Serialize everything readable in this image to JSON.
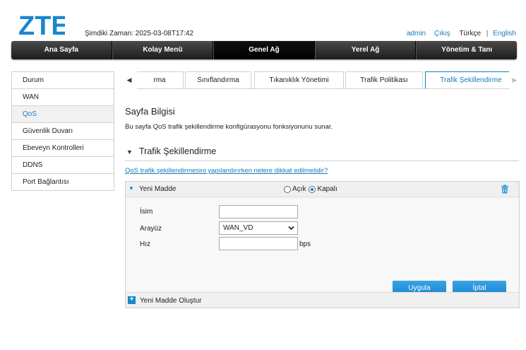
{
  "header": {
    "brand": "ZTE",
    "time_label": "Şimdiki Zaman: 2025-03-08T17:42",
    "links": {
      "admin": "admin",
      "logout": "Çıkış",
      "lang_tr": "Türkçe",
      "separator": "|",
      "lang_en": "English"
    }
  },
  "mainnav": {
    "items": [
      {
        "label": "Ana Sayfa"
      },
      {
        "label": "Kolay Menü"
      },
      {
        "label": "Genel Ağ"
      },
      {
        "label": "Yerel Ağ"
      },
      {
        "label": "Yönetim & Tanı"
      }
    ],
    "active_index": 2
  },
  "sidebar": {
    "items": [
      {
        "label": "Durum"
      },
      {
        "label": "WAN"
      },
      {
        "label": "QoS"
      },
      {
        "label": "Güvenlik Duvarı"
      },
      {
        "label": "Ebeveyn Kontrolleri"
      },
      {
        "label": "DDNS"
      },
      {
        "label": "Port Bağlantısı"
      }
    ],
    "active_index": 2
  },
  "tabs": {
    "items": [
      {
        "label": "rma"
      },
      {
        "label": "Sınıflandırma"
      },
      {
        "label": "Tıkanıklık Yönetimi"
      },
      {
        "label": "Trafik Politikası"
      },
      {
        "label": "Trafik Şekillendirme"
      }
    ],
    "active_index": 4
  },
  "page": {
    "title": "Sayfa Bilgisi",
    "description": "Bu sayfa QoS trafik şekillendirme konfigürasyonu fonksiyonunu sunar."
  },
  "section": {
    "title": "Trafik Şekillendirme",
    "help_link": "QoS trafik şekillendirmesini yapılandırırken nelere dikkat edilmelidir?"
  },
  "entry": {
    "title": "Yeni Madde",
    "radio_on_label": "Açık",
    "radio_off_label": "Kapalı",
    "selected": "Kapalı",
    "fields": {
      "name_label": "İsim",
      "name_value": "",
      "interface_label": "Arayüz",
      "interface_value": "WAN_VD",
      "speed_label": "Hız",
      "speed_value": "",
      "speed_unit": "bps"
    },
    "apply_label": "Uygula",
    "cancel_label": "İptal"
  },
  "footer": {
    "create_label": "Yeni Madde Oluştur"
  },
  "colors": {
    "accent": "#1a7ab9",
    "button": "#2a95dc",
    "nav_bg": "#2b2b2b"
  },
  "icons": {
    "collapse": "triangle-down-icon",
    "delete": "trash-icon",
    "add": "plus-icon",
    "scroll_left": "arrow-left-icon",
    "scroll_right": "arrow-right-icon"
  }
}
